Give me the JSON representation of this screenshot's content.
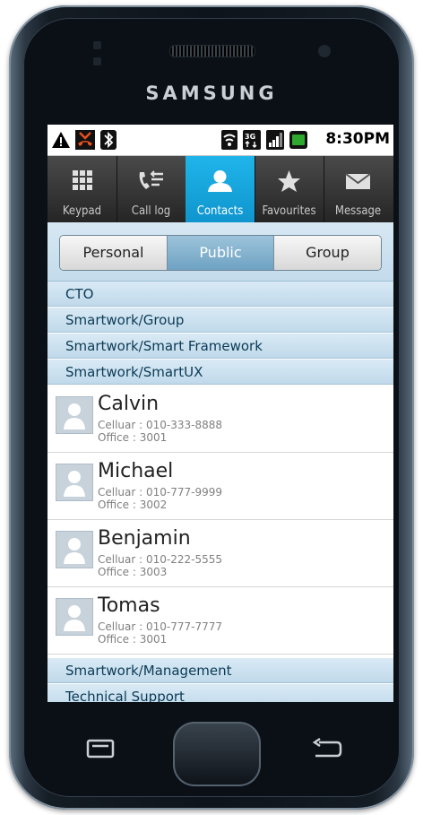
{
  "device": {
    "brand": "SAMSUNG"
  },
  "status_bar": {
    "time": "8:30PM",
    "icons": [
      "warning-icon",
      "missed-call-icon",
      "bluetooth-icon",
      "wifi-icon",
      "3g-icon",
      "signal-icon",
      "battery-icon"
    ],
    "battery_color": "#2fa82f"
  },
  "tabs": [
    {
      "label": "Keypad",
      "icon": "keypad-icon",
      "active": false
    },
    {
      "label": "Call log",
      "icon": "call-log-icon",
      "active": false
    },
    {
      "label": "Contacts",
      "icon": "contacts-icon",
      "active": true
    },
    {
      "label": "Favourites",
      "icon": "star-icon",
      "active": false
    },
    {
      "label": "Message",
      "icon": "envelope-icon",
      "active": false
    }
  ],
  "segments": {
    "selected": "Public",
    "items": [
      "Personal",
      "Public",
      "Group"
    ]
  },
  "groups_top": [
    "CTO",
    "Smartwork/Group",
    "Smartwork/Smart Framework",
    "Smartwork/SmartUX"
  ],
  "contacts": [
    {
      "name": "Calvin",
      "cellular": "Celluar : 010-333-8888",
      "office": "Office : 3001"
    },
    {
      "name": "Michael",
      "cellular": "Celluar : 010-777-9999",
      "office": "Office : 3002"
    },
    {
      "name": "Benjamin",
      "cellular": "Celluar : 010-222-5555",
      "office": "Office : 3003"
    },
    {
      "name": "Tomas",
      "cellular": "Celluar : 010-777-7777",
      "office": "Office : 3001"
    }
  ],
  "groups_bottom": [
    "Smartwork/Management",
    "Technical Support"
  ],
  "colors": {
    "accent": "#1fa8e0",
    "group_header": "#cfe3f0",
    "tab_bar": "#333333"
  }
}
